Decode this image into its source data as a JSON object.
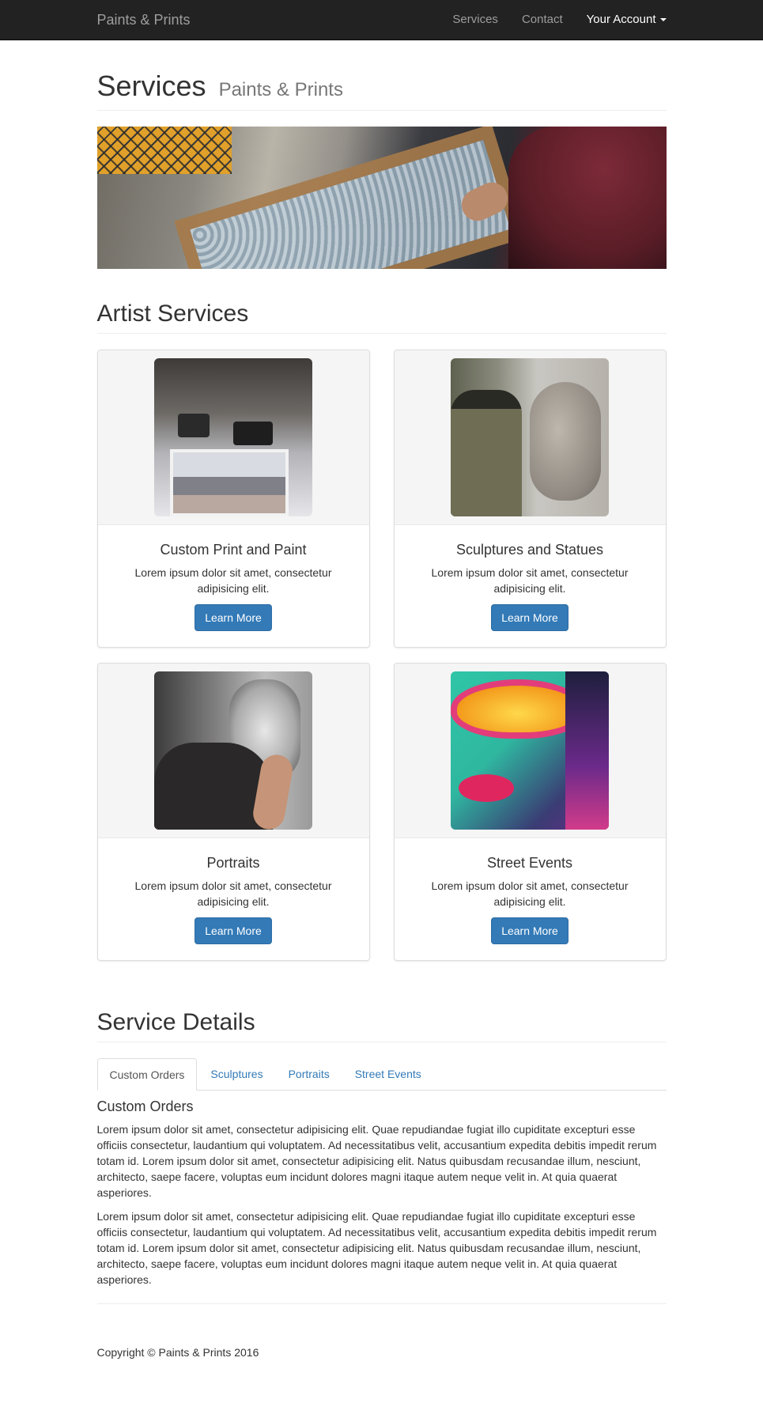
{
  "navbar": {
    "brand": "Paints & Prints",
    "links": [
      "Services",
      "Contact"
    ],
    "account": "Your Account"
  },
  "page_header": {
    "title": "Services",
    "subtitle": "Paints & Prints"
  },
  "artist_services": {
    "heading": "Artist Services",
    "cards": [
      {
        "title": "Custom Print and Paint",
        "text": "Lorem ipsum dolor sit amet, consectetur adipisicing elit.",
        "button": "Learn More"
      },
      {
        "title": "Sculptures and Statues",
        "text": "Lorem ipsum dolor sit amet, consectetur adipisicing elit.",
        "button": "Learn More"
      },
      {
        "title": "Portraits",
        "text": "Lorem ipsum dolor sit amet, consectetur adipisicing elit.",
        "button": "Learn More"
      },
      {
        "title": "Street Events",
        "text": "Lorem ipsum dolor sit amet, consectetur adipisicing elit.",
        "button": "Learn More"
      }
    ]
  },
  "service_details": {
    "heading": "Service Details",
    "tabs": [
      "Custom Orders",
      "Sculptures",
      "Portraits",
      "Street Events"
    ],
    "active_tab_title": "Custom Orders",
    "paragraphs": [
      "Lorem ipsum dolor sit amet, consectetur adipisicing elit. Quae repudiandae fugiat illo cupiditate excepturi esse officiis consectetur, laudantium qui voluptatem. Ad necessitatibus velit, accusantium expedita debitis impedit rerum totam id. Lorem ipsum dolor sit amet, consectetur adipisicing elit. Natus quibusdam recusandae illum, nesciunt, architecto, saepe facere, voluptas eum incidunt dolores magni itaque autem neque velit in. At quia quaerat asperiores.",
      "Lorem ipsum dolor sit amet, consectetur adipisicing elit. Quae repudiandae fugiat illo cupiditate excepturi esse officiis consectetur, laudantium qui voluptatem. Ad necessitatibus velit, accusantium expedita debitis impedit rerum totam id. Lorem ipsum dolor sit amet, consectetur adipisicing elit. Natus quibusdam recusandae illum, nesciunt, architecto, saepe facere, voluptas eum incidunt dolores magni itaque autem neque velit in. At quia quaerat asperiores."
    ]
  },
  "footer": {
    "copyright": "Copyright © Paints & Prints 2016"
  },
  "colors": {
    "navbar_bg": "#222222",
    "primary": "#337ab7",
    "card_top_bg": "#f5f5f5"
  }
}
